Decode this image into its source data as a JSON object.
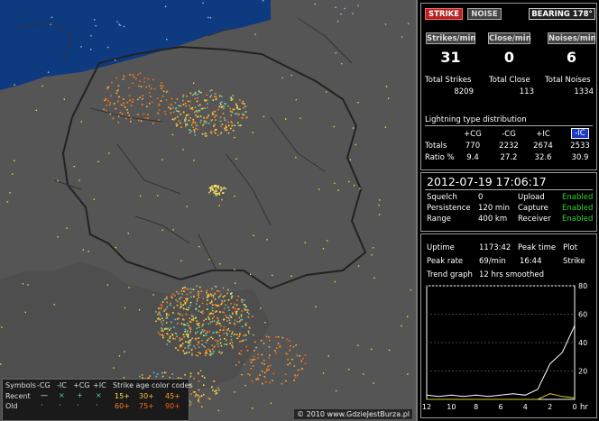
{
  "toolbar": {
    "strike": "STRIKE",
    "noise": "NOISE",
    "bearing": "BEARING 178°"
  },
  "rates": {
    "strikes_label": "Strikes/min",
    "close_label": "Close/min",
    "noises_label": "Noises/min",
    "strikes": "31",
    "close": "0",
    "noises": "6"
  },
  "totals": {
    "strikes_label": "Total Strikes",
    "close_label": "Total Close",
    "noises_label": "Total Noises",
    "strikes": "8209",
    "close": "113",
    "noises": "1334"
  },
  "dist": {
    "title": "Lightning type distribution",
    "headers": [
      "+CG",
      "-CG",
      "+IC",
      "-IC"
    ],
    "totals_label": "Totals",
    "totals": [
      "770",
      "2232",
      "2674",
      "2533"
    ],
    "ratio_label": "Ratio %",
    "ratio": [
      "9.4",
      "27.2",
      "32.6",
      "30.9"
    ]
  },
  "status": {
    "datetime": "2012-07-19 17:06:17",
    "squelch_label": "Squelch",
    "squelch": "0",
    "upload_label": "Upload",
    "upload": "Enabled",
    "persistence_label": "Persistence",
    "persistence": "120 min",
    "capture_label": "Capture",
    "capture": "Enabled",
    "range_label": "Range",
    "range": "400 km",
    "receiver_label": "Receiver",
    "receiver": "Enabled"
  },
  "stats": {
    "uptime_label": "Uptime",
    "uptime": "1173:42",
    "peaktime_label": "Peak time",
    "plot_label": "Plot",
    "peakrate_label": "Peak rate",
    "peakrate": "69/min",
    "peaktime": "16:44",
    "strike_label": "Strike",
    "trend_label": "Trend graph",
    "trend": "12 hrs smoothed"
  },
  "chart_data": {
    "type": "line",
    "x": [
      12,
      11,
      10,
      9,
      8,
      7,
      6,
      5,
      4,
      3,
      2,
      1,
      0
    ],
    "xlabel": "hr",
    "ylim": [
      0,
      80
    ],
    "yticks": [
      20,
      40,
      60,
      80
    ],
    "series": [
      {
        "values": [
          3,
          2,
          3,
          2,
          3,
          2,
          3,
          4,
          3,
          7,
          25,
          33,
          52
        ],
        "color": "#ffffff"
      },
      {
        "values": [
          0,
          0,
          0,
          0,
          0,
          0,
          0,
          0,
          0,
          0,
          4,
          2,
          1
        ],
        "color": "#e0d020"
      }
    ]
  },
  "legend": {
    "symbols_label": "Symbols",
    "sym_types": [
      "-CG",
      "-IC",
      "+CG",
      "+IC"
    ],
    "age_title": "Strike age color codes",
    "recent_label": "Recent",
    "old_label": "Old",
    "recent_ages": [
      "15+",
      "30+",
      "45+"
    ],
    "old_ages": [
      "60+",
      "75+",
      "90+"
    ]
  },
  "credit": "© 2010 www.GdzieJestBurza.pl",
  "colors": {
    "sea": "#0e3a80",
    "land": "#555555",
    "strike_recent": "#ffd23a",
    "strike_old": "#ff7a1a",
    "cyan": "#4ad1c8"
  }
}
